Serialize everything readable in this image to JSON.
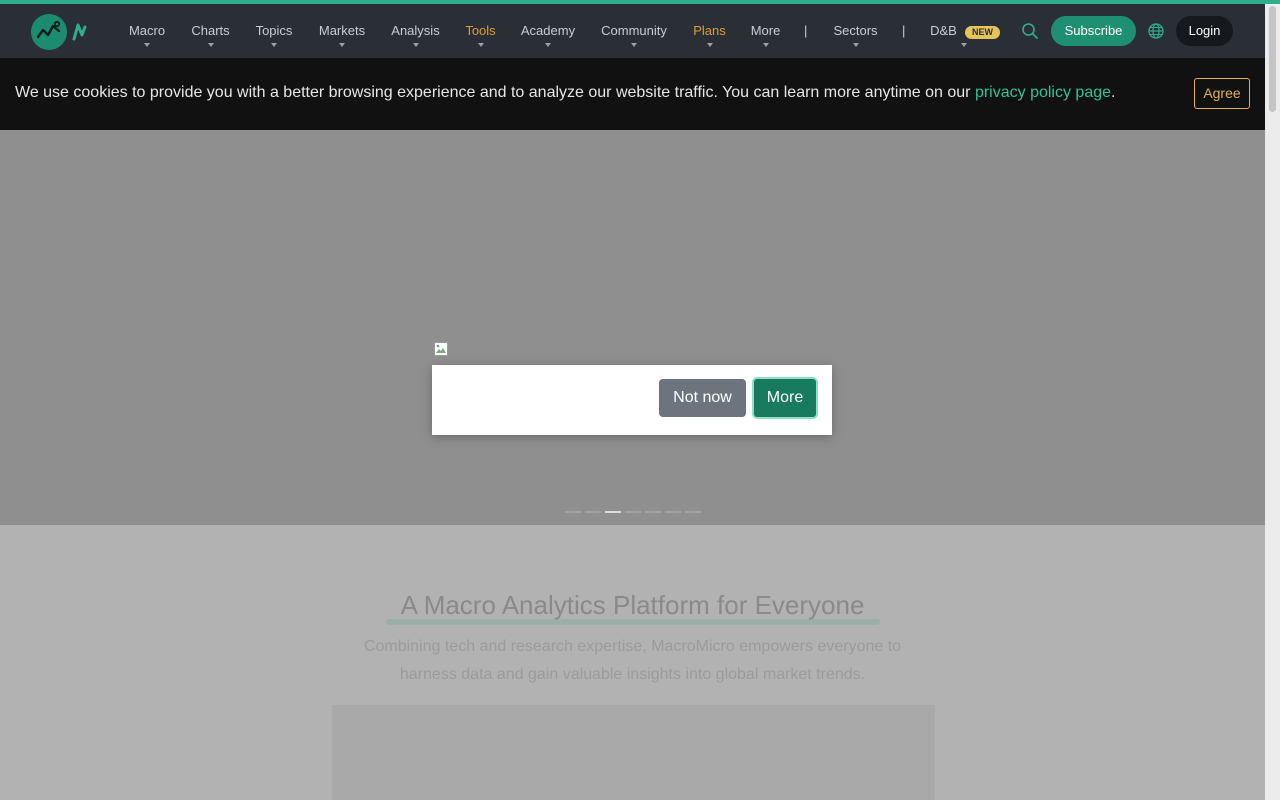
{
  "colors": {
    "accent": "#2fae8a",
    "navbar_bg": "#2a2f36",
    "nav_highlight": "#e09a34",
    "subscribe_bg": "#1f8f72",
    "cookie_link": "#2fc39a",
    "agree_border": "#e2b24a",
    "notnow_bg": "#6c757d",
    "more_bg": "#187a5f"
  },
  "nav": {
    "logo_icon": "macromicro-logo-icon",
    "items": [
      {
        "label": "Macro",
        "highlight": false
      },
      {
        "label": "Charts",
        "highlight": false
      },
      {
        "label": "Topics",
        "highlight": false
      },
      {
        "label": "Markets",
        "highlight": false
      },
      {
        "label": "Analysis",
        "highlight": false
      },
      {
        "label": "Tools",
        "highlight": true
      },
      {
        "label": "Academy",
        "highlight": false
      },
      {
        "label": "Community",
        "highlight": false
      },
      {
        "label": "Plans",
        "highlight": true
      },
      {
        "label": "More",
        "highlight": false
      }
    ],
    "separator": "|",
    "sectors_label": "Sectors",
    "db_label": "D&B",
    "new_badge": "NEW",
    "search_icon": "search-icon",
    "globe_icon": "globe-icon",
    "subscribe_label": "Subscribe",
    "login_label": "Login"
  },
  "cookie": {
    "text": "We use cookies to provide you with a better browsing experience and to analyze our website traffic. You can learn more anytime on our ",
    "link_text": "privacy policy page",
    "trailing": ".",
    "agree_label": "Agree"
  },
  "hero": {
    "slides_total": 7,
    "active_slide": 3
  },
  "main": {
    "tagline": "A Macro Analytics Platform for Everyone",
    "subtagline": "Combining tech and research expertise, MacroMicro empowers everyone to harness data and gain valuable insights into global market trends."
  },
  "modal": {
    "image_icon": "broken-image-icon",
    "not_now_label": "Not now",
    "more_label": "More"
  }
}
